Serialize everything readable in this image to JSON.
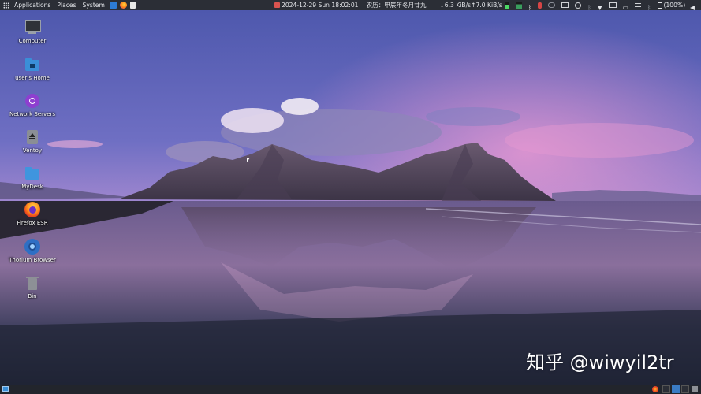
{
  "top_panel": {
    "menus": [
      "Applications",
      "Places",
      "System"
    ],
    "clock": "2024-12-29 Sun 18:02:01",
    "lunar_date": "农历：甲辰年冬月廿九",
    "net_down": "6.3 KiB/s",
    "net_up": "7.0 KiB/s",
    "battery": "(100%)"
  },
  "desktop_icons": [
    {
      "label": "Computer",
      "icon": "computer-icon"
    },
    {
      "label": "user's Home",
      "icon": "home-folder-icon"
    },
    {
      "label": "Network Servers",
      "icon": "network-icon"
    },
    {
      "label": "Ventoy",
      "icon": "eject-drive-icon"
    },
    {
      "label": "MyDesk",
      "icon": "folder-icon"
    },
    {
      "label": "Firefox ESR",
      "icon": "firefox-icon"
    },
    {
      "label": "Thorium Browser",
      "icon": "thorium-icon"
    },
    {
      "label": "Bin",
      "icon": "trash-icon"
    }
  ],
  "watermark": "知乎 @wiwyil2tr",
  "colors": {
    "panel": "#2b2e36",
    "sky_top": "#5a63b8",
    "sky_pink": "#d68fc7",
    "water": "#2b3046"
  }
}
